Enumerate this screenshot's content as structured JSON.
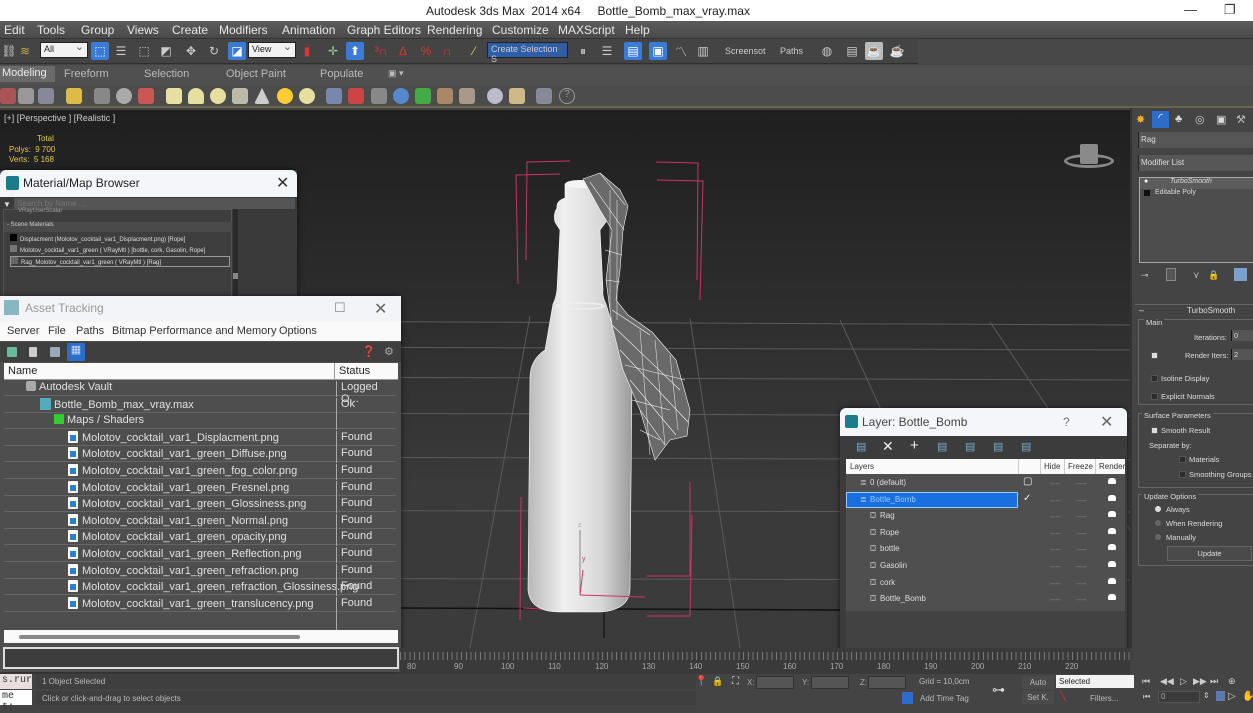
{
  "window": {
    "app_title": "Autodesk 3ds Max  2014 x64",
    "file_title": "Bottle_Bomb_max_vray.max",
    "minimize": "—",
    "restore": "❐"
  },
  "menu": [
    "Edit",
    "Tools",
    "Group",
    "Views",
    "Create",
    "Modifiers",
    "Animation",
    "Graph Editors",
    "Rendering",
    "Customize",
    "MAXScript",
    "Help"
  ],
  "toolbar": {
    "selection_filter": "All",
    "ref_coord": "View",
    "named_selection": "Create Selection S",
    "screenshot_label": "Screensot",
    "paths_label": "Paths"
  },
  "ribbon_tabs": [
    "Modeling",
    "Freeform",
    "Selection",
    "Object Paint",
    "Populate"
  ],
  "viewport": {
    "label": "[+] [Perspective ] [Realistic ]",
    "stats": {
      "header": "Total",
      "polys_label": "Polys:",
      "polys": "9 700",
      "verts_label": "Verts:",
      "verts": "5 168"
    },
    "gizmo_z": "z",
    "gizmo_y": "y"
  },
  "material_browser": {
    "title": "Material/Map Browser",
    "search_placeholder": "Search by Name ...",
    "partial_item": "VRayUserScalar",
    "section": "- Scene Materials",
    "items": [
      "Displacment (Molotov_cocktail_var1_Displacment.png) [Rope]",
      "Molotov_cocktail_var1_green ( VRayMtl ) [bottle, cork, Gasolin, Rope]",
      "Rag_Molotov_cocktail_var1_green ( VRayMtl ) [Rag]"
    ]
  },
  "asset_tracking": {
    "title": "Asset Tracking",
    "menu": [
      "Server",
      "File",
      "Paths",
      "Bitmap Performance and Memory",
      "Options"
    ],
    "columns": [
      "Name",
      "Status"
    ],
    "rows": [
      {
        "name": "Autodesk Vault",
        "status": "Logged O...",
        "level": 1,
        "icon": "vault-icon"
      },
      {
        "name": "Bottle_Bomb_max_vray.max",
        "status": "Ok",
        "level": 2,
        "icon": "max-file-icon"
      },
      {
        "name": "Maps / Shaders",
        "status": "",
        "level": 3,
        "icon": "maps-folder-icon"
      },
      {
        "name": "Molotov_cocktail_var1_Displacment.png",
        "status": "Found",
        "level": 4,
        "icon": "image-file-icon"
      },
      {
        "name": "Molotov_cocktail_var1_green_Diffuse.png",
        "status": "Found",
        "level": 4,
        "icon": "image-file-icon"
      },
      {
        "name": "Molotov_cocktail_var1_green_fog_color.png",
        "status": "Found",
        "level": 4,
        "icon": "image-file-icon"
      },
      {
        "name": "Molotov_cocktail_var1_green_Fresnel.png",
        "status": "Found",
        "level": 4,
        "icon": "image-file-icon"
      },
      {
        "name": "Molotov_cocktail_var1_green_Glossiness.png",
        "status": "Found",
        "level": 4,
        "icon": "image-file-icon"
      },
      {
        "name": "Molotov_cocktail_var1_green_Normal.png",
        "status": "Found",
        "level": 4,
        "icon": "image-file-icon"
      },
      {
        "name": "Molotov_cocktail_var1_green_opacity.png",
        "status": "Found",
        "level": 4,
        "icon": "image-file-icon"
      },
      {
        "name": "Molotov_cocktail_var1_green_Reflection.png",
        "status": "Found",
        "level": 4,
        "icon": "image-file-icon"
      },
      {
        "name": "Molotov_cocktail_var1_green_refraction.png",
        "status": "Found",
        "level": 4,
        "icon": "image-file-icon"
      },
      {
        "name": "Molotov_cocktail_var1_green_refraction_Glossiness.png",
        "status": "Found",
        "level": 4,
        "icon": "image-file-icon"
      },
      {
        "name": "Molotov_cocktail_var1_green_translucency.png",
        "status": "Found",
        "level": 4,
        "icon": "image-file-icon"
      }
    ]
  },
  "layer_dialog": {
    "title": "Layer: Bottle_Bomb",
    "help": "?",
    "columns": [
      "Layers",
      "Hide",
      "Freeze",
      "Render"
    ],
    "rows": [
      {
        "name": "0 (default)",
        "type": "layer",
        "selected": false,
        "current": "box"
      },
      {
        "name": "Bottle_Bomb",
        "type": "layer",
        "selected": true,
        "current": "check"
      },
      {
        "name": "Rag",
        "type": "object"
      },
      {
        "name": "Rope",
        "type": "object"
      },
      {
        "name": "bottle",
        "type": "object"
      },
      {
        "name": "Gasolin",
        "type": "object"
      },
      {
        "name": "cork",
        "type": "object"
      },
      {
        "name": "Bottle_Bomb",
        "type": "object"
      }
    ],
    "dash": "----"
  },
  "command_panel": {
    "object_name": "Rag",
    "modifier_list": "Modifier List",
    "stack": [
      "TurboSmooth",
      "Editable Poly"
    ],
    "rollout_title": "TurboSmooth",
    "main_group": "Main",
    "iterations_label": "Iterations:",
    "iterations": "0",
    "render_iters_label": "Render Iters:",
    "render_iters": "2",
    "render_iters_checked": true,
    "isoline_label": "Isoline Display",
    "isoline": false,
    "explicit_normals_label": "Explicit Normals",
    "explicit_normals": false,
    "surface_group": "Surface Parameters",
    "smooth_result_label": "Smooth Result",
    "smooth_result": true,
    "separate_by": "Separate by:",
    "materials_label": "Materials",
    "smoothing_groups_label": "Smoothing Groups",
    "update_group": "Update Options",
    "update_options": [
      "Always",
      "When Rendering",
      "Manually"
    ],
    "update_selected": "Always",
    "update_button": "Update"
  },
  "timeline": {
    "ticks": [
      "80",
      "90",
      "100",
      "110",
      "120",
      "130",
      "140",
      "150",
      "160",
      "170",
      "180",
      "190",
      "200",
      "210",
      "220"
    ]
  },
  "status": {
    "script_line1": "s.rur",
    "script_line2": "me t:",
    "selected": "1 Object Selected",
    "prompt": "Click or click-and-drag to select objects",
    "x_label": "X:",
    "y_label": "Y:",
    "z_label": "Z:",
    "grid": "Grid = 10,0cm",
    "add_time_tag": "Add Time Tag",
    "auto": "Auto",
    "set_key": "Set K.",
    "key_filter": "Selected",
    "filters": "Filters...",
    "frame": "0"
  }
}
